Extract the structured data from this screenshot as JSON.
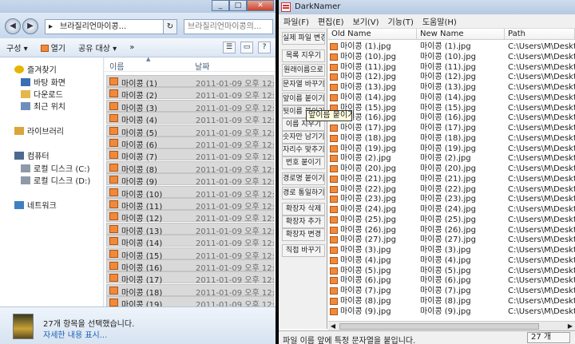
{
  "explorer": {
    "nav_back": "◀",
    "nav_forward": "▶",
    "address_path": "브라질리언마이콩...",
    "address_arrow": "▸",
    "search_placeholder": "브라질리언마이콩의...",
    "toolbar": {
      "organize": "구성 ▾",
      "open": "열기",
      "share": "공유 대상 ▾",
      "more": "»"
    },
    "nav_pane": [
      {
        "label": "즐겨찾기",
        "icon": "star-icon"
      },
      {
        "label": "바탕 화면",
        "icon": "desktop-icon"
      },
      {
        "label": "다운로드",
        "icon": "download-folder-icon"
      },
      {
        "label": "최근 위치",
        "icon": "recent-places-icon"
      },
      {
        "label": "라이브러리",
        "icon": "library-icon"
      },
      {
        "label": "컴퓨터",
        "icon": "computer-icon"
      },
      {
        "label": "로컬 디스크 (C:)",
        "icon": "drive-icon"
      },
      {
        "label": "로컬 디스크 (D:)",
        "icon": "drive-icon"
      },
      {
        "label": "네트워크",
        "icon": "network-icon"
      }
    ],
    "headers": {
      "name": "이름",
      "date": "날짜"
    },
    "files": [
      {
        "name": "마이콩 (1)",
        "date": "2011-01-09 오후 12:"
      },
      {
        "name": "마이콩 (2)",
        "date": "2011-01-09 오후 12:"
      },
      {
        "name": "마이콩 (3)",
        "date": "2011-01-09 오후 12:"
      },
      {
        "name": "마이콩 (4)",
        "date": "2011-01-09 오후 12:"
      },
      {
        "name": "마이콩 (5)",
        "date": "2011-01-09 오후 12:"
      },
      {
        "name": "마이콩 (6)",
        "date": "2011-01-09 오후 12:"
      },
      {
        "name": "마이콩 (7)",
        "date": "2011-01-09 오후 12:"
      },
      {
        "name": "마이콩 (8)",
        "date": "2011-01-09 오후 12:"
      },
      {
        "name": "마이콩 (9)",
        "date": "2011-01-09 오후 12:"
      },
      {
        "name": "마이콩 (10)",
        "date": "2011-01-09 오후 12:"
      },
      {
        "name": "마이콩 (11)",
        "date": "2011-01-09 오후 12:"
      },
      {
        "name": "마이콩 (12)",
        "date": "2011-01-09 오후 12:"
      },
      {
        "name": "마이콩 (13)",
        "date": "2011-01-09 오후 12:"
      },
      {
        "name": "마이콩 (14)",
        "date": "2011-01-09 오후 12:"
      },
      {
        "name": "마이콩 (15)",
        "date": "2011-01-09 오후 12:"
      },
      {
        "name": "마이콩 (16)",
        "date": "2011-01-09 오후 12:"
      },
      {
        "name": "마이콩 (17)",
        "date": "2011-01-09 오후 12:"
      },
      {
        "name": "마이콩 (18)",
        "date": "2011-01-09 오후 12:"
      },
      {
        "name": "마이콩 (19)",
        "date": "2011-01-09 오후 12:"
      }
    ],
    "details": {
      "selection": "27개 항목을 선택했습니다.",
      "more_link": "자세한 내용 표시..."
    }
  },
  "darknamer": {
    "title": "DarkNamer",
    "menus": [
      "파일(F)",
      "편집(E)",
      "보기(V)",
      "기능(T)",
      "도움말(H)"
    ],
    "side_buttons": [
      "실제 파일 변경",
      "목록 지우기",
      "원래이름으로",
      "문자열 바꾸기",
      "앞이름 붙이기",
      "뒷이름 붙이기",
      "이름 지우기",
      "숫자만 남기기",
      "자리수 맞추기",
      "번호 붙이기",
      "경로명 붙이기",
      "경로 통일하기",
      "확장자 삭제",
      "확장자 추가",
      "확장자 변경",
      "직접 바꾸기"
    ],
    "columns": [
      "Old Name",
      "New Name",
      "Path"
    ],
    "rows": [
      {
        "old": "마이콩 (1).jpg",
        "new": "마이콩 (1).jpg",
        "path": "C:\\Users\\M\\Deskt"
      },
      {
        "old": "마이콩 (10).jpg",
        "new": "마이콩 (10).jpg",
        "path": "C:\\Users\\M\\Deskt"
      },
      {
        "old": "마이콩 (11).jpg",
        "new": "마이콩 (11).jpg",
        "path": "C:\\Users\\M\\Deskt"
      },
      {
        "old": "마이콩 (12).jpg",
        "new": "마이콩 (12).jpg",
        "path": "C:\\Users\\M\\Deskt"
      },
      {
        "old": "마이콩 (13).jpg",
        "new": "마이콩 (13).jpg",
        "path": "C:\\Users\\M\\Deskt"
      },
      {
        "old": "마이콩 (14).jpg",
        "new": "마이콩 (14).jpg",
        "path": "C:\\Users\\M\\Deskt"
      },
      {
        "old": "마이콩 (15).jpg",
        "new": "마이콩 (15).jpg",
        "path": "C:\\Users\\M\\Deskt"
      },
      {
        "old": "마이콩 (16).jpg",
        "new": "마이콩 (16).jpg",
        "path": "C:\\Users\\M\\Deskt"
      },
      {
        "old": "마이콩 (17).jpg",
        "new": "마이콩 (17).jpg",
        "path": "C:\\Users\\M\\Deskt"
      },
      {
        "old": "마이콩 (18).jpg",
        "new": "마이콩 (18).jpg",
        "path": "C:\\Users\\M\\Deskt"
      },
      {
        "old": "마이콩 (19).jpg",
        "new": "마이콩 (19).jpg",
        "path": "C:\\Users\\M\\Deskt"
      },
      {
        "old": "마이콩 (2).jpg",
        "new": "마이콩 (2).jpg",
        "path": "C:\\Users\\M\\Deskt"
      },
      {
        "old": "마이콩 (20).jpg",
        "new": "마이콩 (20).jpg",
        "path": "C:\\Users\\M\\Deskt"
      },
      {
        "old": "마이콩 (21).jpg",
        "new": "마이콩 (21).jpg",
        "path": "C:\\Users\\M\\Deskt"
      },
      {
        "old": "마이콩 (22).jpg",
        "new": "마이콩 (22).jpg",
        "path": "C:\\Users\\M\\Deskt"
      },
      {
        "old": "마이콩 (23).jpg",
        "new": "마이콩 (23).jpg",
        "path": "C:\\Users\\M\\Deskt"
      },
      {
        "old": "마이콩 (24).jpg",
        "new": "마이콩 (24).jpg",
        "path": "C:\\Users\\M\\Deskt"
      },
      {
        "old": "마이콩 (25).jpg",
        "new": "마이콩 (25).jpg",
        "path": "C:\\Users\\M\\Deskt"
      },
      {
        "old": "마이콩 (26).jpg",
        "new": "마이콩 (26).jpg",
        "path": "C:\\Users\\M\\Deskt"
      },
      {
        "old": "마이콩 (27).jpg",
        "new": "마이콩 (27).jpg",
        "path": "C:\\Users\\M\\Deskt"
      },
      {
        "old": "마이콩 (3).jpg",
        "new": "마이콩 (3).jpg",
        "path": "C:\\Users\\M\\Deskt"
      },
      {
        "old": "마이콩 (4).jpg",
        "new": "마이콩 (4).jpg",
        "path": "C:\\Users\\M\\Deskt"
      },
      {
        "old": "마이콩 (5).jpg",
        "new": "마이콩 (5).jpg",
        "path": "C:\\Users\\M\\Deskt"
      },
      {
        "old": "마이콩 (6).jpg",
        "new": "마이콩 (6).jpg",
        "path": "C:\\Users\\M\\Deskt"
      },
      {
        "old": "마이콩 (7).jpg",
        "new": "마이콩 (7).jpg",
        "path": "C:\\Users\\M\\Deskt"
      },
      {
        "old": "마이콩 (8).jpg",
        "new": "마이콩 (8).jpg",
        "path": "C:\\Users\\M\\Deskt"
      },
      {
        "old": "마이콩 (9).jpg",
        "new": "마이콩 (9).jpg",
        "path": "C:\\Users\\M\\Deskt"
      }
    ],
    "tooltip": "앞이름 붙이기",
    "status_text": "파일 이름 앞에 특정 문자열을 붙입니다.",
    "status_count": "27 개"
  }
}
